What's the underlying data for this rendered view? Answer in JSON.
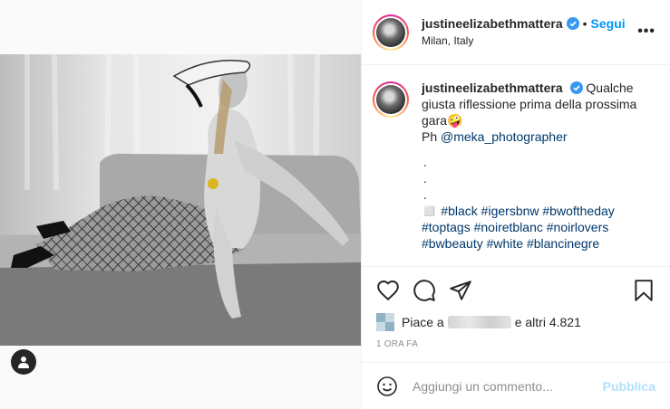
{
  "post": {
    "username": "justineelizabethmattera",
    "location": "Milan, Italy",
    "follow_label": "Segui",
    "dot": "•",
    "more": "•••"
  },
  "caption": {
    "username": "justineelizabethmattera",
    "text_1": "Qualche giusta riflessione prima della prossima gara",
    "emoji": "🤪",
    "ph_prefix": "Ph",
    "mention": "@meka_photographer",
    "dots": [
      ".",
      ".",
      "."
    ],
    "square": "◻️",
    "hashtags_1": "#black #igersbnw #bwoftheday",
    "hashtags_2": "#toptags #noiretblanc #noirlovers",
    "hashtags_3": "#bwbeauty #white #blancinegre"
  },
  "likes": {
    "prefix": "Piace a",
    "others": "e altri 4.821"
  },
  "time_ago": "1 ORA FA",
  "comment": {
    "placeholder": "Aggiungi un commento...",
    "post_label": "Pubblica"
  },
  "icons": {
    "like": "heart-icon",
    "comment": "comment-icon",
    "share": "share-icon",
    "save": "bookmark-icon",
    "emoji": "emoji-icon",
    "tag": "user-tag-icon"
  },
  "colors": {
    "accent": "#0095f6",
    "link": "#00376b",
    "muted": "#8e8e8e",
    "post_disabled": "#b2dffc"
  }
}
